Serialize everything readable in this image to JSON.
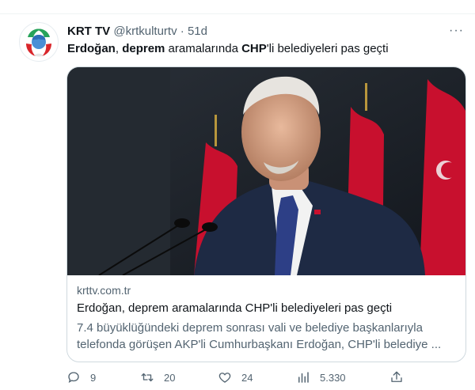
{
  "tweet": {
    "author_name": "KRT TV",
    "handle": "@krtkulturtv",
    "separator": "·",
    "time": "51d",
    "more": "···",
    "text_parts": [
      "Erdoğan",
      ", ",
      "deprem",
      " aramalarında ",
      "CHP",
      "'li belediyeleri pas geçti"
    ]
  },
  "card": {
    "domain": "krttv.com.tr",
    "title": "Erdoğan, deprem aramalarında CHP'li belediyeleri pas geçti",
    "description": "7.4 büyüklüğündeki deprem sonrası vali ve belediye başkanlarıyla telefonda görüşen AKP'li Cumhurbaşkanı Erdoğan, CHP'li belediye ..."
  },
  "actions": {
    "reply_count": "9",
    "retweet_count": "20",
    "like_count": "24",
    "view_count": "5.330"
  },
  "icons": {
    "reply": "reply-icon",
    "retweet": "retweet-icon",
    "like": "heart-icon",
    "views": "analytics-icon",
    "share": "share-icon",
    "more": "more-icon"
  },
  "colors": {
    "text_primary": "#0f1419",
    "text_secondary": "#536471",
    "border": "#cfd9de",
    "flag_red": "#c8102e"
  }
}
